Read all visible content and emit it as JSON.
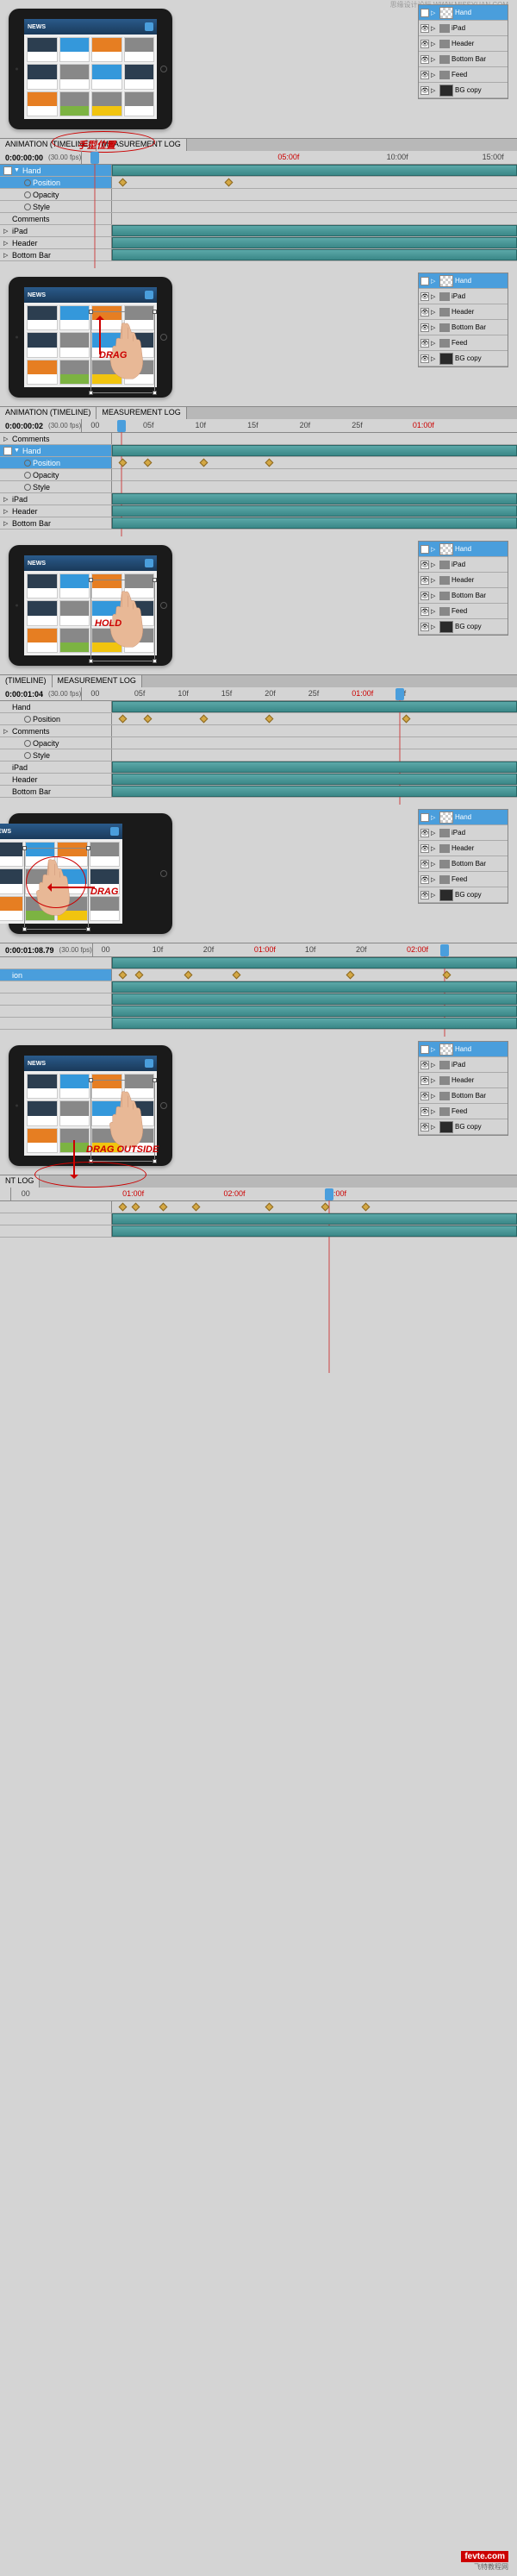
{
  "watermark": "思缘设计论坛 WWW.MISSYUAN.COM",
  "footer": {
    "site": "fevte.com",
    "subtitle": "飞特教程网"
  },
  "layers": {
    "items": [
      {
        "name": "Hand",
        "selected": true,
        "thumb": "checker"
      },
      {
        "name": "iPad",
        "selected": false,
        "thumb": "checker",
        "folder": true
      },
      {
        "name": "Header",
        "selected": false,
        "folder": true
      },
      {
        "name": "Bottom Bar",
        "selected": false,
        "folder": true
      },
      {
        "name": "Feed",
        "selected": false,
        "folder": true
      },
      {
        "name": "BG copy",
        "selected": false,
        "thumb": "dark"
      }
    ]
  },
  "sections": [
    {
      "annotation": "手型位置",
      "timeline": {
        "tabs": [
          "ANIMATION (TIMELINE)",
          "MEASUREMENT LOG"
        ],
        "time": "0:00:00:00",
        "fps": "(30.00 fps)",
        "ticks": [
          {
            "t": "00",
            "p": 2
          },
          {
            "t": "05:00f",
            "p": 45,
            "red": true
          },
          {
            "t": "10:00f",
            "p": 70
          },
          {
            "t": "15:00f",
            "p": 92
          }
        ],
        "playhead": 2,
        "rows": [
          {
            "label": "Hand",
            "selected": true,
            "filled": true,
            "toggle": "▼",
            "eye": true
          },
          {
            "label": "Position",
            "selected": true,
            "indent": 1,
            "icon": "stopwatch",
            "keys": [
              2,
              28
            ]
          },
          {
            "label": "Opacity",
            "indent": 1,
            "icon": "stopwatch"
          },
          {
            "label": "Style",
            "indent": 1,
            "icon": "stopwatch"
          },
          {
            "label": "Comments"
          },
          {
            "label": "iPad",
            "filled": true,
            "toggle": "▷"
          },
          {
            "label": "Header",
            "filled": true,
            "toggle": "▷"
          },
          {
            "label": "Bottom Bar",
            "filled": true,
            "toggle": "▷"
          }
        ]
      }
    },
    {
      "annotation": "DRAG",
      "hand": true,
      "arrow": "up",
      "timeline": {
        "tabs": [
          "ANIMATION (TIMELINE)",
          "MEASUREMENT LOG"
        ],
        "time": "0:00:00:02",
        "fps": "(30.00 fps)",
        "ticks": [
          {
            "t": "00",
            "p": 2
          },
          {
            "t": "05f",
            "p": 14
          },
          {
            "t": "10f",
            "p": 26
          },
          {
            "t": "15f",
            "p": 38
          },
          {
            "t": "20f",
            "p": 50
          },
          {
            "t": "25f",
            "p": 62
          },
          {
            "t": "01:00f",
            "p": 76,
            "red": true
          }
        ],
        "playhead": 8,
        "rows": [
          {
            "label": "Comments",
            "toggle": "▷"
          },
          {
            "label": "Hand",
            "selected": true,
            "filled": true,
            "toggle": "▼",
            "eye": true
          },
          {
            "label": "Position",
            "selected": true,
            "indent": 1,
            "icon": "stopwatch",
            "keys": [
              2,
              8,
              22,
              38
            ]
          },
          {
            "label": "Opacity",
            "indent": 1,
            "icon": "stopwatch"
          },
          {
            "label": "Style",
            "indent": 1,
            "icon": "stopwatch"
          },
          {
            "label": "iPad",
            "filled": true,
            "toggle": "▷"
          },
          {
            "label": "Header",
            "filled": true,
            "toggle": "▷"
          },
          {
            "label": "Bottom Bar",
            "filled": true,
            "toggle": "▷"
          }
        ]
      }
    },
    {
      "annotation": "HOLD",
      "hand": true,
      "timeline": {
        "tabs": [
          "(TIMELINE)",
          "MEASUREMENT LOG"
        ],
        "time": "0:00:01:04",
        "fps": "(30.00 fps)",
        "ticks": [
          {
            "t": "00",
            "p": 2
          },
          {
            "t": "05f",
            "p": 12
          },
          {
            "t": "10f",
            "p": 22
          },
          {
            "t": "15f",
            "p": 32
          },
          {
            "t": "20f",
            "p": 42
          },
          {
            "t": "25f",
            "p": 52
          },
          {
            "t": "01:00f",
            "p": 62,
            "red": true
          },
          {
            "t": "05f",
            "p": 72
          }
        ],
        "playhead": 72,
        "rows": [
          {
            "label": "Hand",
            "filled": true
          },
          {
            "label": "Position",
            "indent": 1,
            "icon": "stopwatch",
            "keys": [
              2,
              8,
              22,
              38,
              72
            ]
          },
          {
            "label": "Comments",
            "toggle": "▷"
          },
          {
            "label": "Opacity",
            "indent": 1,
            "icon": "stopwatch"
          },
          {
            "label": "Style",
            "indent": 1,
            "icon": "stopwatch"
          },
          {
            "label": "iPad",
            "filled": true
          },
          {
            "label": "Header",
            "filled": true
          },
          {
            "label": "Bottom Bar",
            "filled": true
          }
        ]
      }
    },
    {
      "annotation": "DRAG",
      "hand": true,
      "hand_left": true,
      "arrow": "left",
      "timeline": {
        "tabs": [],
        "time": "0:00:01:08.79",
        "fps": "(30.00 fps)",
        "ticks": [
          {
            "t": "00",
            "p": 2
          },
          {
            "t": "10f",
            "p": 14
          },
          {
            "t": "20f",
            "p": 26
          },
          {
            "t": "01:00f",
            "p": 38,
            "red": true
          },
          {
            "t": "10f",
            "p": 50
          },
          {
            "t": "20f",
            "p": 62
          },
          {
            "t": "02:00f",
            "p": 74,
            "red": true
          }
        ],
        "playhead": 82,
        "rows": [
          {
            "label": "",
            "filled": true
          },
          {
            "label": "ion",
            "selected": true,
            "keys": [
              2,
              6,
              18,
              30,
              58,
              82
            ]
          },
          {
            "label": "",
            "filled": true
          },
          {
            "label": "",
            "filled": true
          },
          {
            "label": "",
            "filled": true
          },
          {
            "label": "",
            "filled": true
          }
        ]
      }
    },
    {
      "annotation": "DRAG OUTSIDE",
      "hand": true,
      "arrow": "down",
      "timeline": {
        "tabs": [
          "NT LOG"
        ],
        "time": "",
        "fps": "",
        "ticks": [
          {
            "t": "00",
            "p": 2
          },
          {
            "t": "01:00f",
            "p": 22,
            "red": true
          },
          {
            "t": "02:00f",
            "p": 42,
            "red": true
          },
          {
            "t": "03:00f",
            "p": 62,
            "red": true
          }
        ],
        "playhead": 62,
        "rows": [
          {
            "label": "",
            "keys": [
              2,
              5,
              12,
              20,
              38,
              52,
              62
            ]
          },
          {
            "label": "",
            "filled": true
          },
          {
            "label": "",
            "filled": true
          }
        ]
      }
    }
  ]
}
